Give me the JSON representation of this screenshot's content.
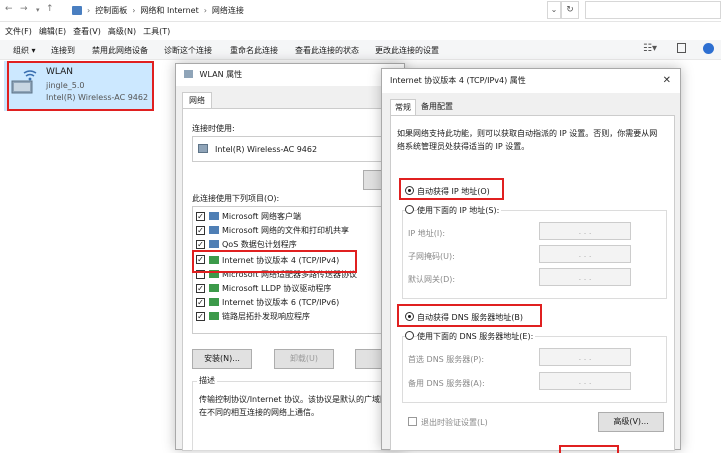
{
  "explorer": {
    "breadcrumb": [
      "控制面板",
      "网络和 Internet",
      "网络连接"
    ],
    "menu": [
      "文件(F)",
      "编辑(E)",
      "查看(V)",
      "高级(N)",
      "工具(T)"
    ],
    "commands": [
      "组织 ▾",
      "连接到",
      "禁用此网络设备",
      "诊断这个连接",
      "重命名此连接",
      "查看此连接的状态",
      "更改此连接的设置"
    ],
    "connection": {
      "name": "WLAN",
      "network": "jingle_5.0",
      "adapter": "Intel(R) Wireless-AC 9462"
    }
  },
  "wlan_dialog": {
    "title": "WLAN 属性",
    "tab": "网络",
    "connect_using_label": "连接时使用:",
    "adapter": "Intel(R) Wireless-AC 9462",
    "items_label": "此连接使用下列项目(O):",
    "items": [
      {
        "label": "Microsoft 网络客户端",
        "checked": true
      },
      {
        "label": "Microsoft 网络的文件和打印机共享",
        "checked": true
      },
      {
        "label": "QoS 数据包计划程序",
        "checked": true
      },
      {
        "label": "Internet 协议版本 4 (TCP/IPv4)",
        "checked": true
      },
      {
        "label": "Microsoft 网络适配器多路传送器协议",
        "checked": false
      },
      {
        "label": "Microsoft LLDP 协议驱动程序",
        "checked": true
      },
      {
        "label": "Internet 协议版本 6 (TCP/IPv6)",
        "checked": true
      },
      {
        "label": "链路层拓扑发现响应程序",
        "checked": true
      }
    ],
    "install_button": "安装(N)...",
    "uninstall_button": "卸载(U)",
    "description_label": "描述",
    "description_line1": "传输控制协议/Internet 协议。该协议是默认的广域网",
    "description_line2": "在不同的相互连接的网络上通信。"
  },
  "ipv4_dialog": {
    "title": "Internet 协议版本 4 (TCP/IPv4) 属性",
    "close": "✕",
    "tabs": [
      "常规",
      "备用配置"
    ],
    "intro_line1": "如果网络支持此功能，则可以获取自动指派的 IP 设置。否则，你需要从网",
    "intro_line2": "络系统管理员处获得适当的 IP 设置。",
    "auto_ip": "自动获得 IP 地址(O)",
    "manual_ip": "使用下面的 IP 地址(S):",
    "ip_label": "IP 地址(I):",
    "mask_label": "子网掩码(U):",
    "gateway_label": "默认网关(D):",
    "auto_dns": "自动获得 DNS 服务器地址(B)",
    "manual_dns": "使用下面的 DNS 服务器地址(E):",
    "preferred_dns_label": "首选 DNS 服务器(P):",
    "alternate_dns_label": "备用 DNS 服务器(A):",
    "validate_label": "退出时验证设置(L)",
    "advanced_button": "高级(V)...",
    "ip_dots": ". . ."
  }
}
